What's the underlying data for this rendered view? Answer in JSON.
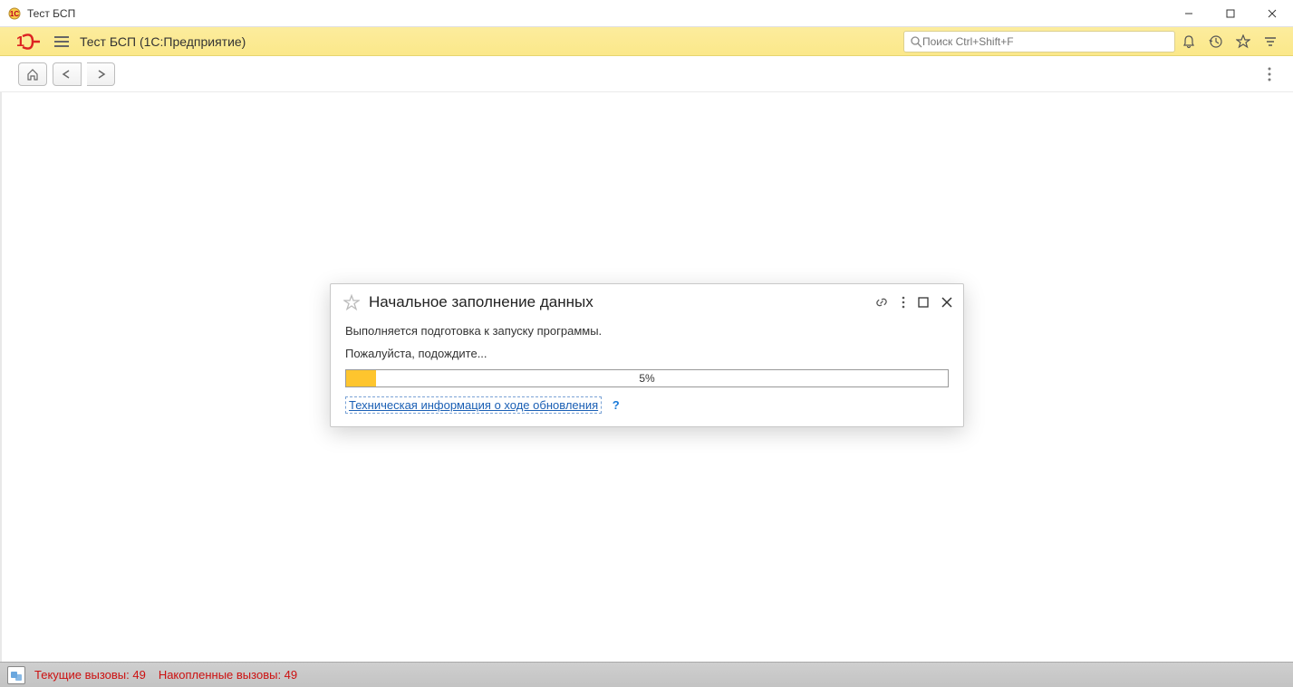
{
  "window": {
    "title": "Тест БСП"
  },
  "toolbar": {
    "app_title": "Тест БСП  (1С:Предприятие)",
    "search_placeholder": "Поиск Ctrl+Shift+F"
  },
  "dialog": {
    "title": "Начальное заполнение данных",
    "line1": "Выполняется подготовка к запуску программы.",
    "line2": "Пожалуйста, подождите...",
    "progress_percent": 5,
    "progress_label": "5%",
    "tech_link": "Техническая информация о ходе обновления",
    "help": "?"
  },
  "status": {
    "current_calls": "Текущие вызовы: 49",
    "accumulated_calls": "Накопленные вызовы: 49"
  }
}
